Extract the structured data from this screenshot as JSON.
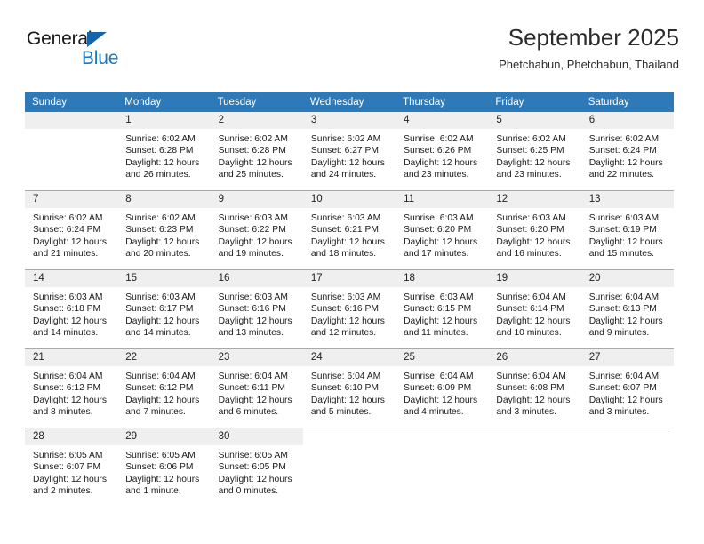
{
  "brand": {
    "name_top": "General",
    "name_bottom": "Blue",
    "triangle_color": "#1565a8",
    "blue_text_color": "#1c78c0"
  },
  "header": {
    "title": "September 2025",
    "subtitle": "Phetchabun, Phetchabun, Thailand"
  },
  "theme": {
    "header_row_bg": "#2e7ab8",
    "daynum_bg": "#efefef",
    "row_divider": "#1565a8"
  },
  "weekdays": [
    "Sunday",
    "Monday",
    "Tuesday",
    "Wednesday",
    "Thursday",
    "Friday",
    "Saturday"
  ],
  "weeks": [
    [
      {
        "day": "",
        "lines": []
      },
      {
        "day": "1",
        "lines": [
          "Sunrise: 6:02 AM",
          "Sunset: 6:28 PM",
          "Daylight: 12 hours",
          "and 26 minutes."
        ]
      },
      {
        "day": "2",
        "lines": [
          "Sunrise: 6:02 AM",
          "Sunset: 6:28 PM",
          "Daylight: 12 hours",
          "and 25 minutes."
        ]
      },
      {
        "day": "3",
        "lines": [
          "Sunrise: 6:02 AM",
          "Sunset: 6:27 PM",
          "Daylight: 12 hours",
          "and 24 minutes."
        ]
      },
      {
        "day": "4",
        "lines": [
          "Sunrise: 6:02 AM",
          "Sunset: 6:26 PM",
          "Daylight: 12 hours",
          "and 23 minutes."
        ]
      },
      {
        "day": "5",
        "lines": [
          "Sunrise: 6:02 AM",
          "Sunset: 6:25 PM",
          "Daylight: 12 hours",
          "and 23 minutes."
        ]
      },
      {
        "day": "6",
        "lines": [
          "Sunrise: 6:02 AM",
          "Sunset: 6:24 PM",
          "Daylight: 12 hours",
          "and 22 minutes."
        ]
      }
    ],
    [
      {
        "day": "7",
        "lines": [
          "Sunrise: 6:02 AM",
          "Sunset: 6:24 PM",
          "Daylight: 12 hours",
          "and 21 minutes."
        ]
      },
      {
        "day": "8",
        "lines": [
          "Sunrise: 6:02 AM",
          "Sunset: 6:23 PM",
          "Daylight: 12 hours",
          "and 20 minutes."
        ]
      },
      {
        "day": "9",
        "lines": [
          "Sunrise: 6:03 AM",
          "Sunset: 6:22 PM",
          "Daylight: 12 hours",
          "and 19 minutes."
        ]
      },
      {
        "day": "10",
        "lines": [
          "Sunrise: 6:03 AM",
          "Sunset: 6:21 PM",
          "Daylight: 12 hours",
          "and 18 minutes."
        ]
      },
      {
        "day": "11",
        "lines": [
          "Sunrise: 6:03 AM",
          "Sunset: 6:20 PM",
          "Daylight: 12 hours",
          "and 17 minutes."
        ]
      },
      {
        "day": "12",
        "lines": [
          "Sunrise: 6:03 AM",
          "Sunset: 6:20 PM",
          "Daylight: 12 hours",
          "and 16 minutes."
        ]
      },
      {
        "day": "13",
        "lines": [
          "Sunrise: 6:03 AM",
          "Sunset: 6:19 PM",
          "Daylight: 12 hours",
          "and 15 minutes."
        ]
      }
    ],
    [
      {
        "day": "14",
        "lines": [
          "Sunrise: 6:03 AM",
          "Sunset: 6:18 PM",
          "Daylight: 12 hours",
          "and 14 minutes."
        ]
      },
      {
        "day": "15",
        "lines": [
          "Sunrise: 6:03 AM",
          "Sunset: 6:17 PM",
          "Daylight: 12 hours",
          "and 14 minutes."
        ]
      },
      {
        "day": "16",
        "lines": [
          "Sunrise: 6:03 AM",
          "Sunset: 6:16 PM",
          "Daylight: 12 hours",
          "and 13 minutes."
        ]
      },
      {
        "day": "17",
        "lines": [
          "Sunrise: 6:03 AM",
          "Sunset: 6:16 PM",
          "Daylight: 12 hours",
          "and 12 minutes."
        ]
      },
      {
        "day": "18",
        "lines": [
          "Sunrise: 6:03 AM",
          "Sunset: 6:15 PM",
          "Daylight: 12 hours",
          "and 11 minutes."
        ]
      },
      {
        "day": "19",
        "lines": [
          "Sunrise: 6:04 AM",
          "Sunset: 6:14 PM",
          "Daylight: 12 hours",
          "and 10 minutes."
        ]
      },
      {
        "day": "20",
        "lines": [
          "Sunrise: 6:04 AM",
          "Sunset: 6:13 PM",
          "Daylight: 12 hours",
          "and 9 minutes."
        ]
      }
    ],
    [
      {
        "day": "21",
        "lines": [
          "Sunrise: 6:04 AM",
          "Sunset: 6:12 PM",
          "Daylight: 12 hours",
          "and 8 minutes."
        ]
      },
      {
        "day": "22",
        "lines": [
          "Sunrise: 6:04 AM",
          "Sunset: 6:12 PM",
          "Daylight: 12 hours",
          "and 7 minutes."
        ]
      },
      {
        "day": "23",
        "lines": [
          "Sunrise: 6:04 AM",
          "Sunset: 6:11 PM",
          "Daylight: 12 hours",
          "and 6 minutes."
        ]
      },
      {
        "day": "24",
        "lines": [
          "Sunrise: 6:04 AM",
          "Sunset: 6:10 PM",
          "Daylight: 12 hours",
          "and 5 minutes."
        ]
      },
      {
        "day": "25",
        "lines": [
          "Sunrise: 6:04 AM",
          "Sunset: 6:09 PM",
          "Daylight: 12 hours",
          "and 4 minutes."
        ]
      },
      {
        "day": "26",
        "lines": [
          "Sunrise: 6:04 AM",
          "Sunset: 6:08 PM",
          "Daylight: 12 hours",
          "and 3 minutes."
        ]
      },
      {
        "day": "27",
        "lines": [
          "Sunrise: 6:04 AM",
          "Sunset: 6:07 PM",
          "Daylight: 12 hours",
          "and 3 minutes."
        ]
      }
    ],
    [
      {
        "day": "28",
        "lines": [
          "Sunrise: 6:05 AM",
          "Sunset: 6:07 PM",
          "Daylight: 12 hours",
          "and 2 minutes."
        ]
      },
      {
        "day": "29",
        "lines": [
          "Sunrise: 6:05 AM",
          "Sunset: 6:06 PM",
          "Daylight: 12 hours",
          "and 1 minute."
        ]
      },
      {
        "day": "30",
        "lines": [
          "Sunrise: 6:05 AM",
          "Sunset: 6:05 PM",
          "Daylight: 12 hours",
          "and 0 minutes."
        ]
      },
      {
        "day": "",
        "lines": []
      },
      {
        "day": "",
        "lines": []
      },
      {
        "day": "",
        "lines": []
      },
      {
        "day": "",
        "lines": []
      }
    ]
  ]
}
